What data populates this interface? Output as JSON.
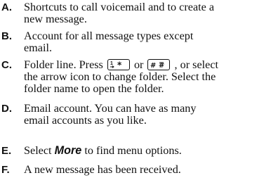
{
  "items": [
    {
      "letter": "A.",
      "lines": [
        "Shortcuts to call voicemail and to create a",
        "new message."
      ]
    },
    {
      "letter": "B.",
      "lines": [
        "Account for all message types except",
        "email."
      ]
    },
    {
      "letter": "C.",
      "line1_a": "Folder line. Press",
      "line1_or": "or",
      "line1_b": ", or select",
      "lines_rest": [
        "the arrow icon to change folder. Select the",
        "folder name to open the folder."
      ],
      "key1_icon": "star-key-icon",
      "key2_icon": "hash-key-icon"
    },
    {
      "letter": "D.",
      "lines": [
        "Email account. You can have as many",
        "email accounts as you like."
      ]
    },
    {
      "letter": "E.",
      "pre": "Select ",
      "emph": "More",
      "post": " to find menu options."
    },
    {
      "letter": "F.",
      "lines": [
        "A new message has been received."
      ]
    }
  ]
}
